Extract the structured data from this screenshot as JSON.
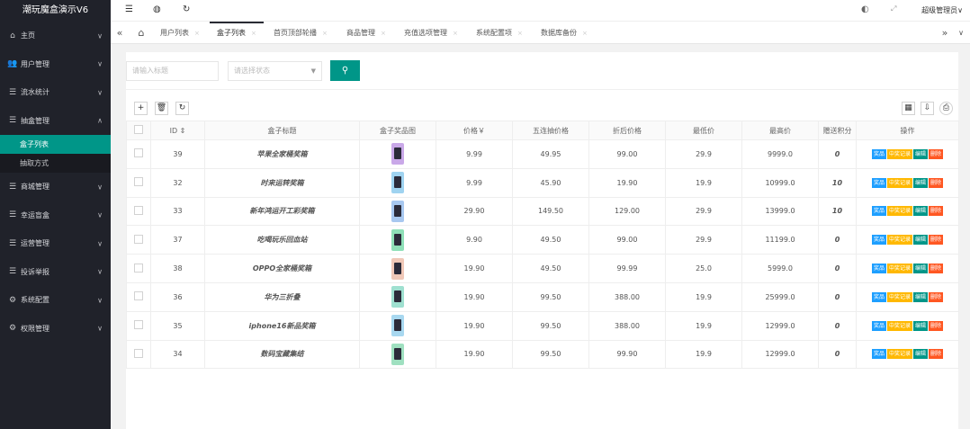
{
  "app": {
    "title": "潮玩魔盒演示V6",
    "user": "超级管理员∨"
  },
  "sidebar": {
    "items": [
      {
        "label": "主页",
        "icon": "home-icon",
        "glyph": "⌂"
      },
      {
        "label": "用户管理",
        "icon": "users-icon",
        "glyph": "👥"
      },
      {
        "label": "流水统计",
        "icon": "list-icon",
        "glyph": "☰"
      },
      {
        "label": "抽盒管理",
        "icon": "list-icon",
        "glyph": "☰",
        "open": true
      },
      {
        "label": "商城管理",
        "icon": "list-icon",
        "glyph": "☰"
      },
      {
        "label": "幸运盲盒",
        "icon": "list-icon",
        "glyph": "☰"
      },
      {
        "label": "运营管理",
        "icon": "list-icon",
        "glyph": "☰"
      },
      {
        "label": "投诉举报",
        "icon": "list-icon",
        "glyph": "☰"
      },
      {
        "label": "系统配置",
        "icon": "settings-icon",
        "glyph": "⚙"
      },
      {
        "label": "权限管理",
        "icon": "gear-icon",
        "glyph": "⚙"
      }
    ],
    "subitems": [
      {
        "label": "盒子列表",
        "active": true
      },
      {
        "label": "抽取方式",
        "active": false
      }
    ]
  },
  "tabs": [
    {
      "label": "用户列表"
    },
    {
      "label": "盒子列表",
      "active": true
    },
    {
      "label": "首页顶部轮播"
    },
    {
      "label": "商品管理"
    },
    {
      "label": "充值选项管理"
    },
    {
      "label": "系统配置项"
    },
    {
      "label": "数据库备份"
    }
  ],
  "search": {
    "title_placeholder": "请输入标题",
    "status_placeholder": "请选择状态"
  },
  "table": {
    "headers": [
      "ID ⇕",
      "盒子标题",
      "盒子奖品图",
      "价格￥",
      "五连抽价格",
      "折后价格",
      "最低价",
      "最高价",
      "赠送积分",
      "操作"
    ],
    "actions": [
      "奖品",
      "中奖记录",
      "编辑",
      "删除"
    ],
    "rows": [
      {
        "id": "39",
        "title": "苹果全家桶奖箱",
        "thumb": "#c9a8e8",
        "price": "9.99",
        "five": "49.95",
        "discount": "99.00",
        "min": "29.9",
        "max": "9999.0",
        "points": "0"
      },
      {
        "id": "32",
        "title": "时来运转奖箱",
        "thumb": "#9fd3f0",
        "price": "9.99",
        "five": "45.90",
        "discount": "19.90",
        "min": "19.9",
        "max": "10999.0",
        "points": "10"
      },
      {
        "id": "33",
        "title": "新年鸿运开工彩奖箱",
        "thumb": "#a8c8f0",
        "price": "29.90",
        "five": "149.50",
        "discount": "129.00",
        "min": "29.9",
        "max": "13999.0",
        "points": "10"
      },
      {
        "id": "37",
        "title": "吃喝玩乐回血站",
        "thumb": "#8fe0b8",
        "price": "9.90",
        "five": "49.50",
        "discount": "99.00",
        "min": "29.9",
        "max": "11199.0",
        "points": "0"
      },
      {
        "id": "38",
        "title": "OPPO全家桶奖箱",
        "thumb": "#f0c8b8",
        "price": "19.90",
        "five": "49.50",
        "discount": "99.99",
        "min": "25.0",
        "max": "5999.0",
        "points": "0"
      },
      {
        "id": "36",
        "title": "华为三折叠",
        "thumb": "#9fe0d0",
        "price": "19.90",
        "five": "99.50",
        "discount": "388.00",
        "min": "19.9",
        "max": "25999.0",
        "points": "0"
      },
      {
        "id": "35",
        "title": "iphone16新品奖箱",
        "thumb": "#a8d8f0",
        "price": "19.90",
        "five": "99.50",
        "discount": "388.00",
        "min": "19.9",
        "max": "12999.0",
        "points": "0"
      },
      {
        "id": "34",
        "title": "数码宝藏集结",
        "thumb": "#9fe0c0",
        "price": "19.90",
        "five": "99.50",
        "discount": "99.90",
        "min": "19.9",
        "max": "12999.0",
        "points": "0"
      }
    ]
  }
}
